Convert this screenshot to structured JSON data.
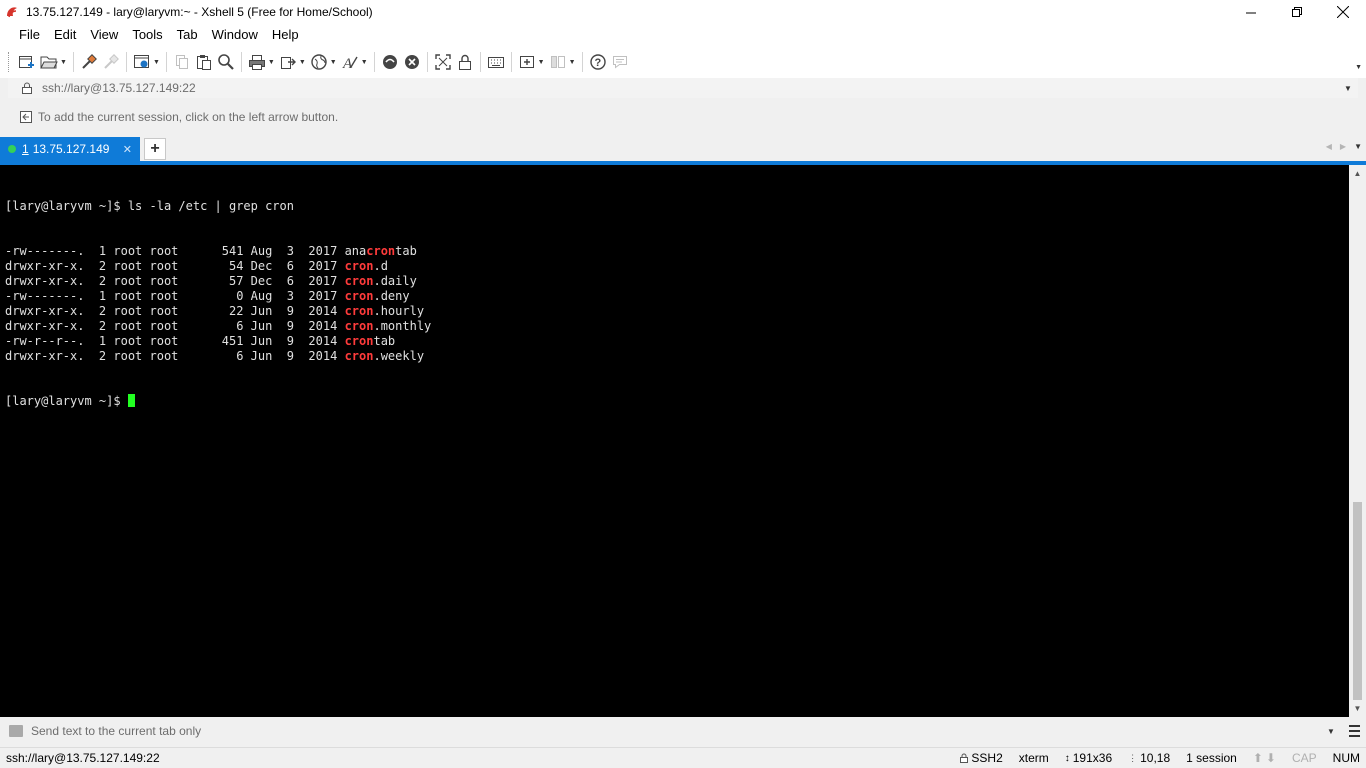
{
  "window": {
    "title": "13.75.127.149 - lary@laryvm:~ - Xshell 5 (Free for Home/School)"
  },
  "menu": [
    "File",
    "Edit",
    "View",
    "Tools",
    "Tab",
    "Window",
    "Help"
  ],
  "toolbar": {
    "icons": [
      "new-session-icon",
      "open-folder-icon",
      "connect-icon",
      "disconnect-icon",
      "properties-icon",
      "copy-icon",
      "paste-icon",
      "find-icon",
      "print-icon",
      "transfer-icon",
      "globe-icon",
      "font-icon",
      "xftp-icon",
      "xmanager-icon",
      "fullscreen-icon",
      "lock-icon",
      "keyboard-icon",
      "new-tab-icon",
      "layout-icon",
      "help-icon",
      "chat-icon"
    ]
  },
  "address": {
    "text": "ssh://lary@13.75.127.149:22"
  },
  "hint": {
    "text": "To add the current session, click on the left arrow button."
  },
  "tabs": [
    {
      "number": "1",
      "label": "13.75.127.149"
    }
  ],
  "terminal": {
    "prompt_command": "[lary@laryvm ~]$ ls -la /etc | grep cron",
    "lines": [
      {
        "prefix": "-rw-------.  1 root root      541 Aug  3  2017 ",
        "pre": "ana",
        "match": "cron",
        "post": "tab"
      },
      {
        "prefix": "drwxr-xr-x.  2 root root       54 Dec  6  2017 ",
        "pre": "",
        "match": "cron",
        "post": ".d"
      },
      {
        "prefix": "drwxr-xr-x.  2 root root       57 Dec  6  2017 ",
        "pre": "",
        "match": "cron",
        "post": ".daily"
      },
      {
        "prefix": "-rw-------.  1 root root        0 Aug  3  2017 ",
        "pre": "",
        "match": "cron",
        "post": ".deny"
      },
      {
        "prefix": "drwxr-xr-x.  2 root root       22 Jun  9  2014 ",
        "pre": "",
        "match": "cron",
        "post": ".hourly"
      },
      {
        "prefix": "drwxr-xr-x.  2 root root        6 Jun  9  2014 ",
        "pre": "",
        "match": "cron",
        "post": ".monthly"
      },
      {
        "prefix": "-rw-r--r--.  1 root root      451 Jun  9  2014 ",
        "pre": "",
        "match": "cron",
        "post": "tab"
      },
      {
        "prefix": "drwxr-xr-x.  2 root root        6 Jun  9  2014 ",
        "pre": "",
        "match": "cron",
        "post": ".weekly"
      }
    ],
    "final_prompt": "[lary@laryvm ~]$ ",
    "highlight_color": "#ff3b3b",
    "cursor_color": "#22ff22"
  },
  "compose": {
    "placeholder": "Send text to the current tab only"
  },
  "status": {
    "path": "ssh://lary@13.75.127.149:22",
    "protocol": "SSH2",
    "terminal_type": "xterm",
    "size": "191x36",
    "cursor_pos": "10,18",
    "sessions": "1 session",
    "cap": "CAP",
    "num": "NUM"
  },
  "colors": {
    "accent": "#0f7bd8",
    "terminal_bg": "#000000"
  }
}
